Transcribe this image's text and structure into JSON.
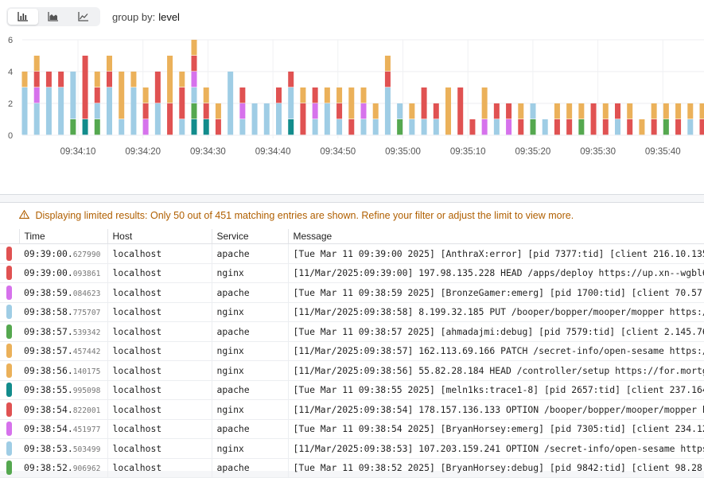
{
  "colors": {
    "error": "#e05252",
    "warn": "#ebb15a",
    "info": "#9fcde5",
    "debug": "#55a84f",
    "emerg": "#d672ec",
    "trace": "#128c8c"
  },
  "toolbar": {
    "buttons": [
      {
        "icon": "bar-chart-icon",
        "active": true
      },
      {
        "icon": "area-chart-icon",
        "active": false
      },
      {
        "icon": "line-chart-icon",
        "active": false
      }
    ],
    "group_by_label": "group by:",
    "group_by_value": "level"
  },
  "chart_data": {
    "type": "bar",
    "stacked": true,
    "ylim": [
      0,
      6
    ],
    "yticks": [
      "0",
      "2",
      "4",
      "6"
    ],
    "xticks": [
      "09:34:10",
      "09:34:20",
      "09:34:30",
      "09:34:40",
      "09:34:50",
      "09:35:00",
      "09:35:10",
      "09:35:20",
      "09:35:30",
      "09:35:40"
    ],
    "series_order": [
      "trace",
      "debug",
      "info",
      "emerg",
      "error",
      "warn"
    ],
    "bars": [
      {
        "info": 3,
        "warn": 1
      },
      {
        "info": 2,
        "emerg": 1,
        "error": 1,
        "warn": 1
      },
      {
        "info": 3,
        "error": 1
      },
      {
        "info": 3,
        "error": 1
      },
      {
        "debug": 1,
        "info": 3
      },
      {
        "trace": 1,
        "error": 4
      },
      {
        "debug": 1,
        "info": 1,
        "error": 1,
        "warn": 1
      },
      {
        "info": 3,
        "error": 1,
        "warn": 1
      },
      {
        "info": 1,
        "warn": 3
      },
      {
        "info": 3,
        "warn": 1
      },
      {
        "error": 1,
        "emerg": 1,
        "warn": 1
      },
      {
        "info": 2,
        "error": 2
      },
      {
        "error": 2,
        "warn": 3
      },
      {
        "error": 2,
        "info": 1,
        "warn": 1
      },
      {
        "trace": 1,
        "debug": 1,
        "emerg": 1,
        "error": 1,
        "info": 1,
        "warn": 1
      },
      {
        "trace": 1,
        "error": 1,
        "warn": 1
      },
      {
        "error": 1,
        "warn": 1
      },
      {
        "info": 4
      },
      {
        "error": 1,
        "emerg": 1,
        "info": 1
      },
      {
        "info": 2
      },
      {
        "info": 2
      },
      {
        "info": 2,
        "error": 1
      },
      {
        "trace": 1,
        "info": 2,
        "error": 1
      },
      {
        "error": 2,
        "warn": 1
      },
      {
        "info": 1,
        "emerg": 1,
        "error": 1
      },
      {
        "info": 2,
        "warn": 1
      },
      {
        "error": 1,
        "info": 1,
        "warn": 1
      },
      {
        "error": 1,
        "warn": 2
      },
      {
        "info": 1,
        "emerg": 1,
        "warn": 1
      },
      {
        "info": 1,
        "warn": 1
      },
      {
        "error": 1,
        "info": 3,
        "warn": 1
      },
      {
        "debug": 1,
        "info": 1
      },
      {
        "info": 1,
        "warn": 1
      },
      {
        "error": 2,
        "info": 1
      },
      {
        "error": 1,
        "info": 1
      },
      {
        "warn": 3
      },
      {
        "error": 3
      },
      {
        "error": 1
      },
      {
        "emerg": 1,
        "warn": 2
      },
      {
        "error": 1,
        "info": 1
      },
      {
        "error": 1,
        "emerg": 1
      },
      {
        "error": 1,
        "warn": 1
      },
      {
        "debug": 1,
        "info": 1
      },
      {
        "info": 1
      },
      {
        "error": 1,
        "warn": 1
      },
      {
        "error": 1,
        "warn": 1
      },
      {
        "debug": 1,
        "warn": 1
      },
      {
        "error": 2
      },
      {
        "error": 1,
        "warn": 1
      },
      {
        "error": 1,
        "info": 1
      },
      {
        "error": 1,
        "warn": 1
      },
      {
        "warn": 1
      },
      {
        "error": 1,
        "warn": 1
      },
      {
        "debug": 1,
        "warn": 1
      },
      {
        "error": 1,
        "warn": 1
      },
      {
        "info": 1,
        "warn": 1
      },
      {
        "error": 1,
        "warn": 1
      }
    ]
  },
  "warning": {
    "text": "Displaying limited results: Only 50 out of 451 matching entries are shown. Refine your filter or adjust the limit to view more."
  },
  "table": {
    "headers": [
      "Time",
      "Host",
      "Service",
      "Message"
    ],
    "rows": [
      {
        "level": "error",
        "time": "09:39:00.",
        "ms": "627990",
        "host": "localhost",
        "service": "apache",
        "message": "[Tue Mar 11 09:39:00 2025] [AnthraX:error] [pid 7377:tid] [client 216.10.135"
      },
      {
        "level": "error",
        "time": "09:39:00.",
        "ms": "093861",
        "host": "localhost",
        "service": "nginx",
        "message": "[11/Mar/2025:09:39:00] 197.98.135.228 HEAD /apps/deploy https://up.xn--wgbl6"
      },
      {
        "level": "emerg",
        "time": "09:38:59.",
        "ms": "084623",
        "host": "localhost",
        "service": "apache",
        "message": "[Tue Mar 11 09:38:59 2025] [BronzeGamer:emerg] [pid 1700:tid] [client 70.57."
      },
      {
        "level": "info",
        "time": "09:38:58.",
        "ms": "775707",
        "host": "localhost",
        "service": "nginx",
        "message": "[11/Mar/2025:09:38:58] 8.199.32.185 PUT /booper/bopper/mooper/mopper https:/"
      },
      {
        "level": "debug",
        "time": "09:38:57.",
        "ms": "539342",
        "host": "localhost",
        "service": "apache",
        "message": "[Tue Mar 11 09:38:57 2025] [ahmadajmi:debug] [pid 7579:tid] [client 2.145.76"
      },
      {
        "level": "warn",
        "time": "09:38:57.",
        "ms": "457442",
        "host": "localhost",
        "service": "nginx",
        "message": "[11/Mar/2025:09:38:57] 162.113.69.166 PATCH /secret-info/open-sesame https:/"
      },
      {
        "level": "warn",
        "time": "09:38:56.",
        "ms": "140175",
        "host": "localhost",
        "service": "nginx",
        "message": "[11/Mar/2025:09:38:56] 55.82.28.184 HEAD /controller/setup https://for.mortg"
      },
      {
        "level": "trace",
        "time": "09:38:55.",
        "ms": "995098",
        "host": "localhost",
        "service": "apache",
        "message": "[Tue Mar 11 09:38:55 2025] [meln1ks:trace1-8] [pid 2657:tid] [client 237.164"
      },
      {
        "level": "error",
        "time": "09:38:54.",
        "ms": "822001",
        "host": "localhost",
        "service": "nginx",
        "message": "[11/Mar/2025:09:38:54] 178.157.136.133 OPTION /booper/bopper/mooper/mopper h"
      },
      {
        "level": "emerg",
        "time": "09:38:54.",
        "ms": "451977",
        "host": "localhost",
        "service": "apache",
        "message": "[Tue Mar 11 09:38:54 2025] [BryanHorsey:emerg] [pid 7305:tid] [client 234.12"
      },
      {
        "level": "info",
        "time": "09:38:53.",
        "ms": "503499",
        "host": "localhost",
        "service": "nginx",
        "message": "[11/Mar/2025:09:38:53] 107.203.159.241 OPTION /secret-info/open-sesame https"
      },
      {
        "level": "debug",
        "time": "09:38:52.",
        "ms": "906962",
        "host": "localhost",
        "service": "apache",
        "message": "[Tue Mar 11 09:38:52 2025] [BryanHorsey:debug] [pid 9842:tid] [client 98.28."
      }
    ]
  }
}
